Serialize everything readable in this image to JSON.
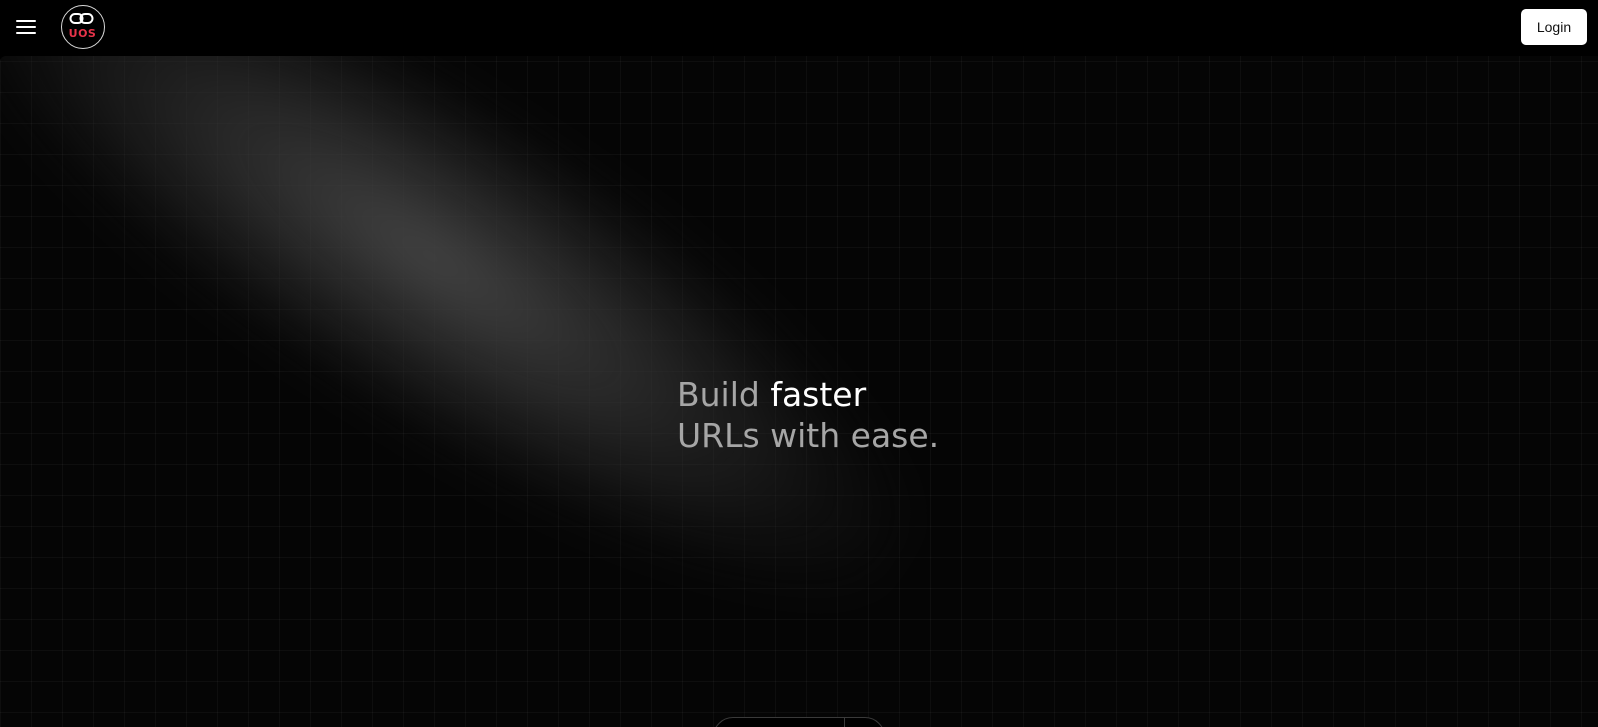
{
  "header": {
    "logo_text": "UOS",
    "login_label": "Login"
  },
  "hero": {
    "headline_prefix": "Build ",
    "headline_accent": "faster",
    "headline_line2": "URLs with ease."
  },
  "icons": {
    "menu": "hamburger-menu-icon",
    "logo_mark": "link-chain-icon"
  },
  "colors": {
    "background": "#000000",
    "logo_accent": "#e8344a",
    "headline_muted": "#a6a6a6",
    "headline_accent": "#ffffff",
    "login_bg": "#ffffff"
  }
}
